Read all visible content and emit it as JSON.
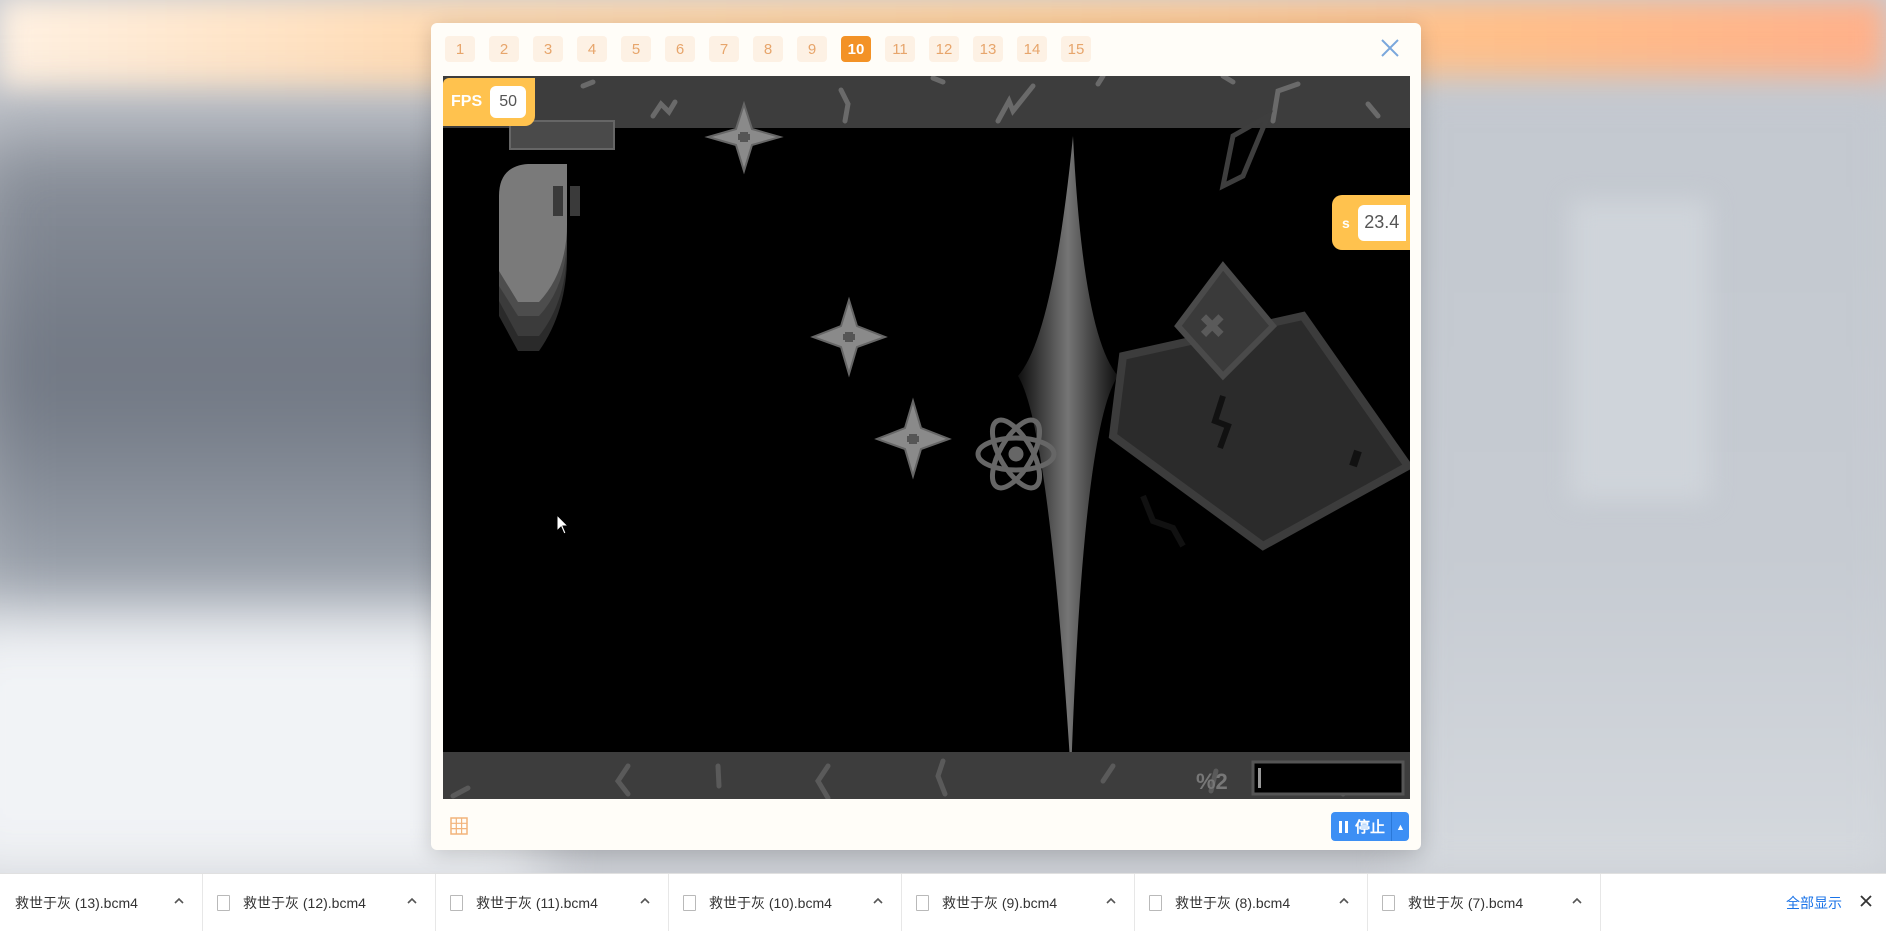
{
  "tabs": [
    "1",
    "2",
    "3",
    "4",
    "5",
    "6",
    "7",
    "8",
    "9",
    "10",
    "11",
    "12",
    "13",
    "14",
    "15"
  ],
  "active_tab": "10",
  "hud": {
    "fps_label": "FPS",
    "fps_value": "50",
    "var_label": "s",
    "var_value": "23.4",
    "bottom_text": "%2"
  },
  "stop_button": {
    "label": "停止"
  },
  "downloads": {
    "items": [
      "救世于灰 (13).bcm4",
      "救世于灰 (12).bcm4",
      "救世于灰 (11).bcm4",
      "救世于灰 (10).bcm4",
      "救世于灰 (9).bcm4",
      "救世于灰 (8).bcm4",
      "救世于灰 (7).bcm4"
    ],
    "show_all": "全部显示"
  },
  "colors": {
    "accent": "#f39226",
    "badge": "#ffc24e",
    "button": "#3d8ff4",
    "link": "#1a73e8"
  },
  "icons": [
    "close-icon",
    "grid-icon",
    "pause-icon",
    "chevron-up-icon",
    "file-icon",
    "cursor-icon"
  ]
}
